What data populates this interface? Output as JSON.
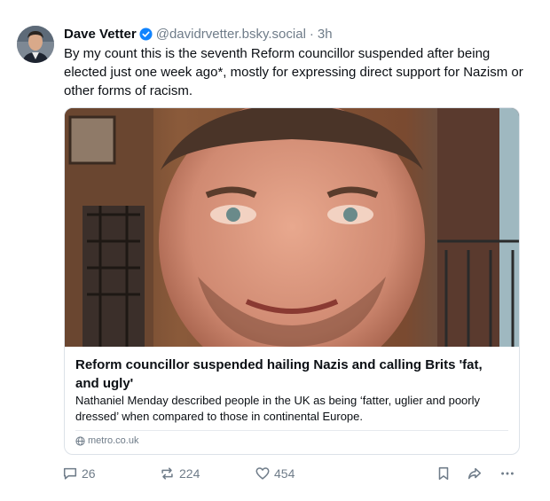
{
  "post": {
    "author_name": "Dave Vetter",
    "author_handle": "@davidrvetter.bsky.social",
    "separator": "·",
    "time": "3h",
    "text": "By my count this is the seventh Reform councillor suspended after being elected just one week ago*, mostly for expressing direct support for Nazism or other forms of racism."
  },
  "link_card": {
    "title": "Reform councillor suspended hailing Nazis and calling Brits 'fat, and ugly'",
    "description": "Nathaniel Menday described people in the UK as being ‘fatter, uglier and poorly dressed’ when compared to those in continental Europe.",
    "source": "metro.co.uk"
  },
  "actions": {
    "replies": "26",
    "reposts": "224",
    "likes": "454"
  },
  "icons": {
    "verified": "verified-badge-icon",
    "reply": "reply-icon",
    "repost": "repost-icon",
    "like": "heart-icon",
    "bookmark": "bookmark-icon",
    "share": "share-icon",
    "more": "more-icon",
    "globe": "globe-icon"
  },
  "colors": {
    "accent": "#1083fe",
    "muted": "#6f7c89",
    "text": "#0b0f14"
  }
}
